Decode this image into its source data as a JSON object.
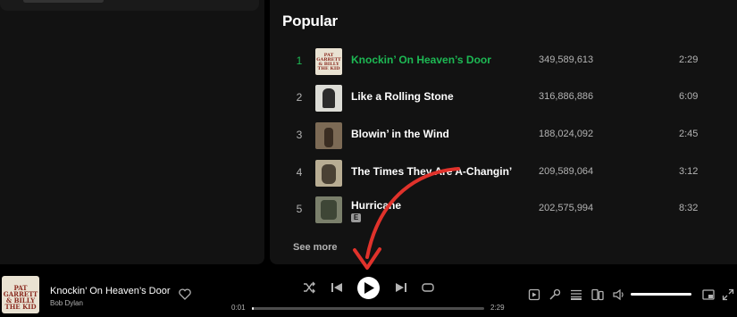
{
  "popular": {
    "title": "Popular",
    "see_more": "See more",
    "tracks": [
      {
        "num": "1",
        "title": "Knockin’ On Heaven’s Door",
        "plays": "349,589,613",
        "duration": "2:29",
        "playing": true,
        "cover_text": "PAT GARRETT & BILLY THE KID"
      },
      {
        "num": "2",
        "title": "Like a Rolling Stone",
        "plays": "316,886,886",
        "duration": "6:09",
        "playing": false
      },
      {
        "num": "3",
        "title": "Blowin’ in the Wind",
        "plays": "188,024,092",
        "duration": "2:45",
        "playing": false
      },
      {
        "num": "4",
        "title": "The Times They Are A-Changin’",
        "plays": "209,589,064",
        "duration": "3:12",
        "playing": false
      },
      {
        "num": "5",
        "title": "Hurricane",
        "plays": "202,575,994",
        "duration": "8:32",
        "playing": false,
        "explicit": "E"
      }
    ]
  },
  "player": {
    "now_playing": {
      "title": "Knockin’ On Heaven’s Door",
      "artist": "Bob Dylan",
      "cover_text": "PAT GARRETT & BILLY THE KID"
    },
    "elapsed": "0:01",
    "total": "2:29",
    "progress_fraction": 0.007,
    "volume_fraction": 1.0
  },
  "icons": {
    "shuffle": "shuffle-icon",
    "previous": "skip-back-icon",
    "play": "play-icon",
    "next": "skip-forward-icon",
    "repeat": "repeat-icon",
    "heart": "heart-icon",
    "now_playing_view": "now-playing-view-icon",
    "lyrics": "microphone-icon",
    "queue": "queue-icon",
    "connect": "connect-device-icon",
    "volume": "volume-icon",
    "miniplayer": "miniplayer-icon",
    "fullscreen": "fullscreen-icon"
  },
  "colors": {
    "accent": "#1db954",
    "annotation_arrow": "#e0322b"
  }
}
